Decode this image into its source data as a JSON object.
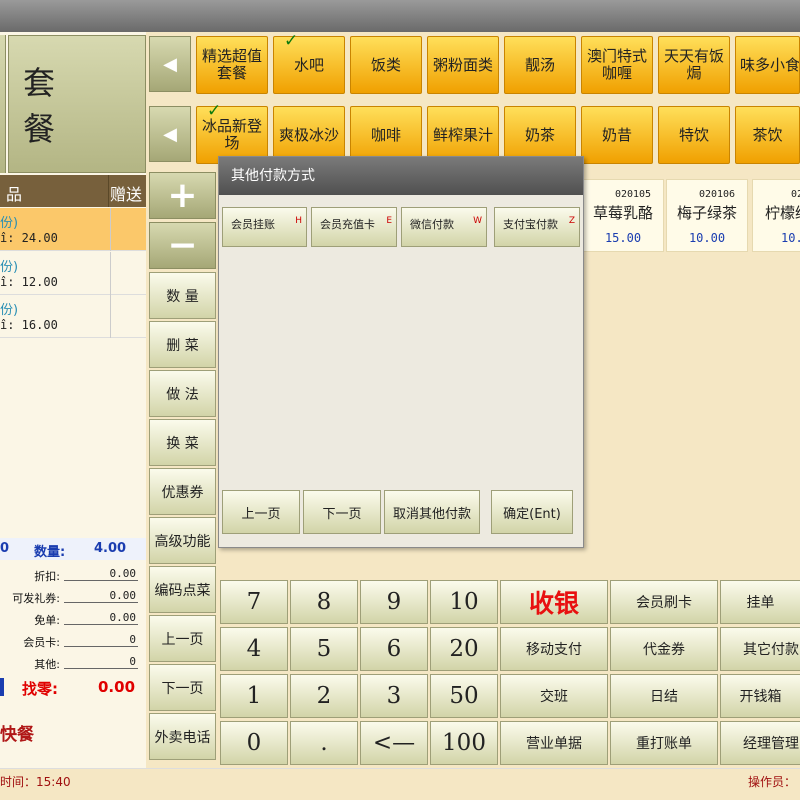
{
  "left": {
    "taocan": "套 餐",
    "header_col1": "品",
    "header_col2": "赠送",
    "orders": [
      {
        "qty": "份)",
        "price": "î: 24.00"
      },
      {
        "qty": "份)",
        "price": "î: 12.00"
      },
      {
        "qty": "份)",
        "price": "î: 16.00"
      }
    ],
    "sum_value": "0",
    "qty_label": "数量:",
    "qty_value": "4.00",
    "fields": [
      {
        "label": "折扣:",
        "value": "0.00"
      },
      {
        "label": "可发礼券:",
        "value": "0.00"
      },
      {
        "label": "免单:",
        "value": "0.00"
      },
      {
        "label": "会员卡:",
        "value": "0"
      },
      {
        "label": "其他:",
        "value": "0"
      }
    ],
    "change_label": "找零:",
    "change_value": "0.00",
    "bottom_text": "快餐"
  },
  "side_buttons": {
    "plus": "+",
    "minus": "−",
    "qty": "数 量",
    "delete": "删 菜",
    "method": "做 法",
    "swap": "换 菜",
    "coupon": "优惠券",
    "advanced": "高级功能",
    "code_order": "编码点菜",
    "prev": "上一页",
    "next": "下一页",
    "takeout": "外卖电话"
  },
  "categories_row1": [
    "精选超值套餐",
    "水吧",
    "饭类",
    "粥粉面类",
    "靓汤",
    "澳门特式咖喱",
    "天天有饭焗",
    "味多小食"
  ],
  "categories_row2": [
    "冰品新登场",
    "爽极冰沙",
    "咖啡",
    "鲜榨果汁",
    "奶茶",
    "奶昔",
    "特饮",
    "茶饮"
  ],
  "products": [
    {
      "code": "020105",
      "name": "草莓乳酪",
      "price": "15.00"
    },
    {
      "code": "020106",
      "name": "梅子绿茶",
      "price": "10.00"
    },
    {
      "code": "02",
      "name": "柠檬绿",
      "price": "10."
    }
  ],
  "keypad": {
    "n7": "7",
    "n8": "8",
    "n9": "9",
    "n10": "10",
    "n4": "4",
    "n5": "5",
    "n6": "6",
    "n20": "20",
    "n1": "1",
    "n2": "2",
    "n3": "3",
    "n50": "50",
    "n0": "0",
    "dot": ".",
    "back": "<—",
    "n100": "100",
    "checkout": "收银",
    "member_swipe": "会员刷卡",
    "hang": "挂单",
    "mobile_pay": "移动支付",
    "voucher": "代金券",
    "other_pay": "其它付款",
    "shift": "交班",
    "daily": "日结",
    "open_drawer": "开钱箱",
    "business_doc": "营业单据",
    "reprint": "重打账单",
    "manager": "经理管理"
  },
  "status": {
    "time_label": "时间：15:40",
    "operator": "操作员："
  },
  "dialog": {
    "title": "其他付款方式",
    "methods": [
      {
        "label": "会员挂账",
        "hotkey": "H"
      },
      {
        "label": "会员充值卡",
        "hotkey": "E"
      },
      {
        "label": "微信付款",
        "hotkey": "W"
      },
      {
        "label": "支付宝付款",
        "hotkey": "Z"
      }
    ],
    "prev": "上一页",
    "next": "下一页",
    "cancel": "取消其他付款",
    "confirm": "确定(Ent)"
  }
}
